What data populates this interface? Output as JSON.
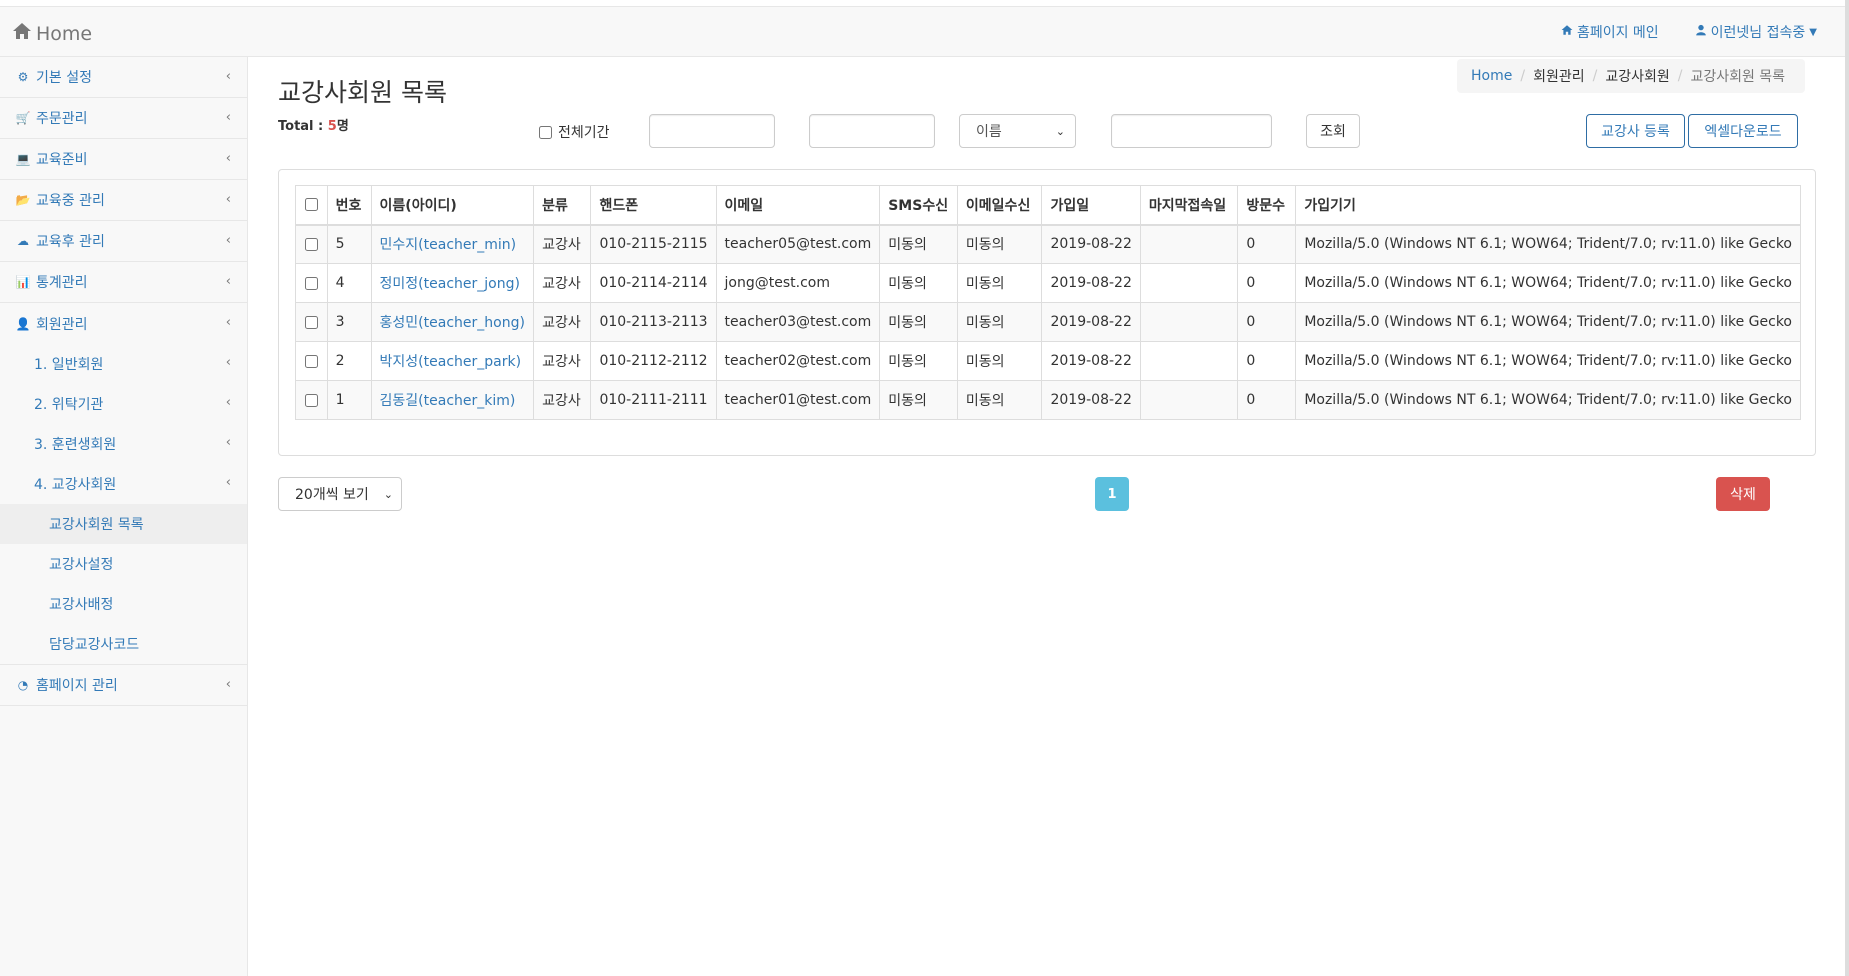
{
  "navbar": {
    "brand": "Home",
    "homepage_link": "홈페이지 메인",
    "user_menu": "이런넷님 접속중"
  },
  "sidebar": {
    "items": [
      {
        "label": "기본 설정",
        "icon": "cogs-icon"
      },
      {
        "label": "주문관리",
        "icon": "cart-icon"
      },
      {
        "label": "교육준비",
        "icon": "laptop-icon"
      },
      {
        "label": "교육중 관리",
        "icon": "folder-open-icon"
      },
      {
        "label": "교육후 관리",
        "icon": "cloud-upload-icon"
      },
      {
        "label": "통계관리",
        "icon": "bar-chart-icon"
      },
      {
        "label": "회원관리",
        "icon": "user-icon"
      }
    ],
    "member_sub": [
      {
        "label": "1. 일반회원"
      },
      {
        "label": "2. 위탁기관"
      },
      {
        "label": "3. 훈련생회원"
      },
      {
        "label": "4. 교강사회원"
      }
    ],
    "teacher_sub": [
      {
        "label": "교강사회원 목록",
        "active": true
      },
      {
        "label": "교강사설정"
      },
      {
        "label": "교강사배정"
      },
      {
        "label": "담당교강사코드"
      }
    ],
    "last_item": {
      "label": "홈페이지 관리",
      "icon": "dashboard-icon"
    }
  },
  "page": {
    "title": "교강사회원 목록",
    "total_label": "Total : ",
    "total_count": "5",
    "total_unit": "명"
  },
  "breadcrumb": [
    "Home",
    "회원관리",
    "교강사회원",
    "교강사회원 목록"
  ],
  "filters": {
    "all_period_label": "전체기간",
    "start_date": "",
    "end_date": "",
    "search_field": "이름",
    "keyword": "",
    "search_button": "조회"
  },
  "actions": {
    "register": "교강사 등록",
    "excel": "엑셀다운로드",
    "delete": "삭제"
  },
  "table": {
    "headers": [
      "번호",
      "이름(아이디)",
      "분류",
      "핸드폰",
      "이메일",
      "SMS수신",
      "이메일수신",
      "가입일",
      "마지막접속일",
      "방문수",
      "가입기기"
    ],
    "rows": [
      [
        "5",
        "민수지(teacher_min)",
        "교강사",
        "010-2115-2115",
        "teacher05@test.com",
        "미동의",
        "미동의",
        "2019-08-22",
        "",
        "0",
        "Mozilla/5.0 (Windows NT 6.1; WOW64; Trident/7.0; rv:11.0) like Gecko"
      ],
      [
        "4",
        "정미정(teacher_jong)",
        "교강사",
        "010-2114-2114",
        "jong@test.com",
        "미동의",
        "미동의",
        "2019-08-22",
        "",
        "0",
        "Mozilla/5.0 (Windows NT 6.1; WOW64; Trident/7.0; rv:11.0) like Gecko"
      ],
      [
        "3",
        "홍성민(teacher_hong)",
        "교강사",
        "010-2113-2113",
        "teacher03@test.com",
        "미동의",
        "미동의",
        "2019-08-22",
        "",
        "0",
        "Mozilla/5.0 (Windows NT 6.1; WOW64; Trident/7.0; rv:11.0) like Gecko"
      ],
      [
        "2",
        "박지성(teacher_park)",
        "교강사",
        "010-2112-2112",
        "teacher02@test.com",
        "미동의",
        "미동의",
        "2019-08-22",
        "",
        "0",
        "Mozilla/5.0 (Windows NT 6.1; WOW64; Trident/7.0; rv:11.0) like Gecko"
      ],
      [
        "1",
        "김동길(teacher_kim)",
        "교강사",
        "010-2111-2111",
        "teacher01@test.com",
        "미동의",
        "미동의",
        "2019-08-22",
        "",
        "0",
        "Mozilla/5.0 (Windows NT 6.1; WOW64; Trident/7.0; rv:11.0) like Gecko"
      ]
    ]
  },
  "pagination": {
    "page_size": "20개씩 보기",
    "current_page": "1"
  },
  "colors": {
    "link": "#337ab7",
    "danger": "#d9534f",
    "info": "#5bc0de"
  }
}
